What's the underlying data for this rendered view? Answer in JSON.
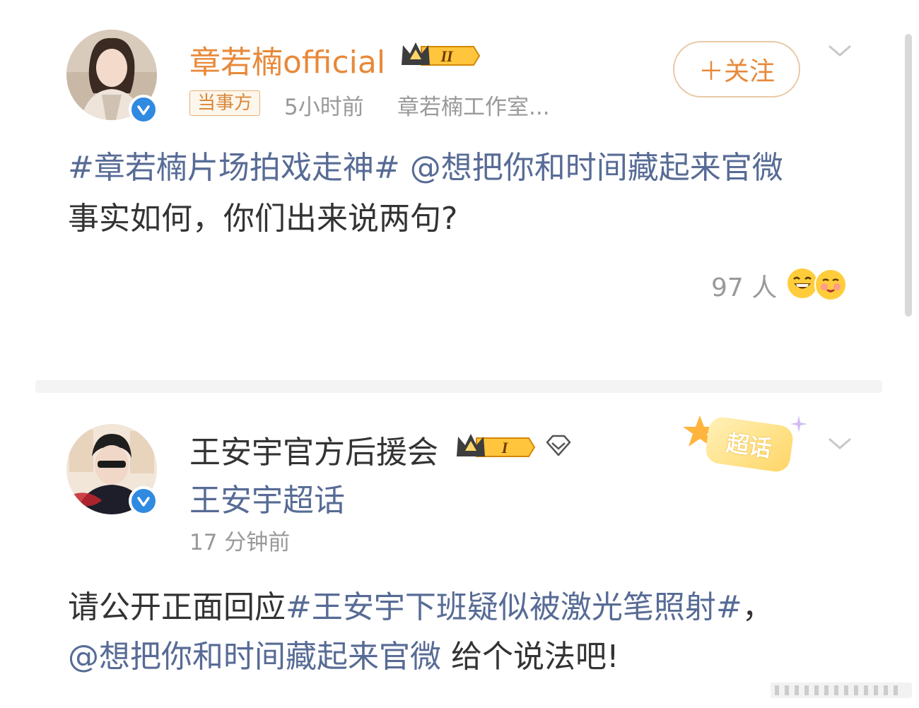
{
  "post1": {
    "username": "章若楠official",
    "level": "II",
    "tag": "当事方",
    "time": "5小时前",
    "source": "章若楠工作室...",
    "follow_label": "＋关注",
    "line1_hashtag": "#章若楠片场拍戏走神#",
    "line1_mention": "@想把你和时间藏起来官微",
    "line2": "事实如何，你们出来说两句?",
    "reaction_count": "97 人"
  },
  "post2": {
    "username": "王安宇官方后援会",
    "level": "I",
    "subtitle": "王安宇超话",
    "time": "17 分钟前",
    "badge": "超话",
    "line1_prefix": "请公开正面回应",
    "line1_hashtag": "#王安宇下班疑似被激光笔照射#",
    "line1_suffix": "，",
    "line2_mention": "@想把你和时间藏起来官微",
    "line2_suffix": " 给个说法吧!"
  },
  "colors": {
    "name_orange": "#e8893a",
    "link_blue": "#576b95",
    "verified_blue": "#2f8ae0",
    "meta_gray": "#999999"
  },
  "icons": [
    "verified-icon",
    "crown-icon",
    "chevron-down-icon",
    "diamond-icon",
    "emoji-laugh-icon",
    "emoji-blush-icon"
  ]
}
